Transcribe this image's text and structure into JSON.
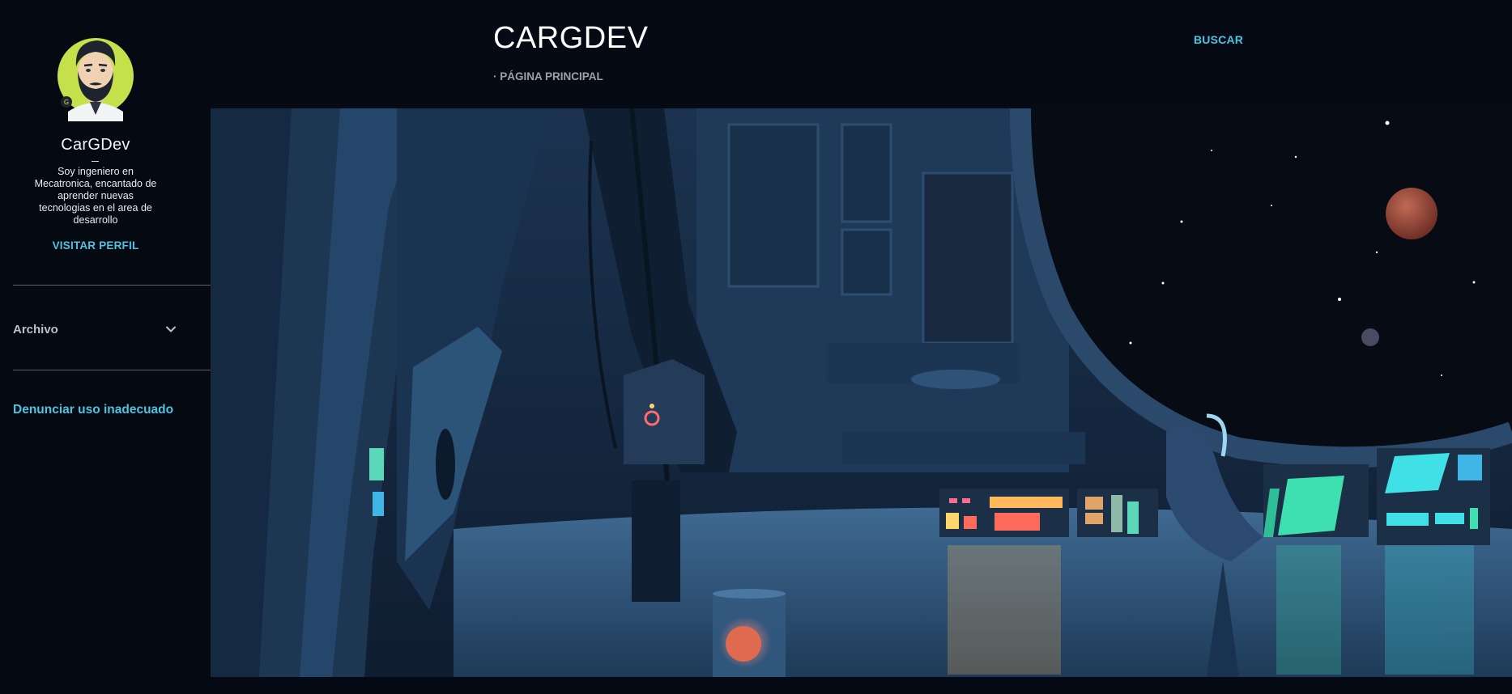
{
  "sidebar": {
    "profile": {
      "name": "CarGDev",
      "bio": "Soy ingeniero en Mecatronica, encantado de aprender nuevas tecnologias en el area de desarrollo",
      "visit_label": "VISITAR PERFIL"
    },
    "archive_label": "Archivo",
    "report_label": "Denunciar uso inadecuado"
  },
  "header": {
    "title": "CARGDEV",
    "breadcrumb": "· PÁGINA PRINCIPAL",
    "search_label": "BUSCAR"
  },
  "colors": {
    "background": "#050a14",
    "accent": "#4fc3e3",
    "muted": "#9aa3ad",
    "avatar_ring": "#c5e04a"
  },
  "icons": {
    "avatar": "bearded-man-avatar",
    "archive_toggle": "chevron-down-icon"
  }
}
